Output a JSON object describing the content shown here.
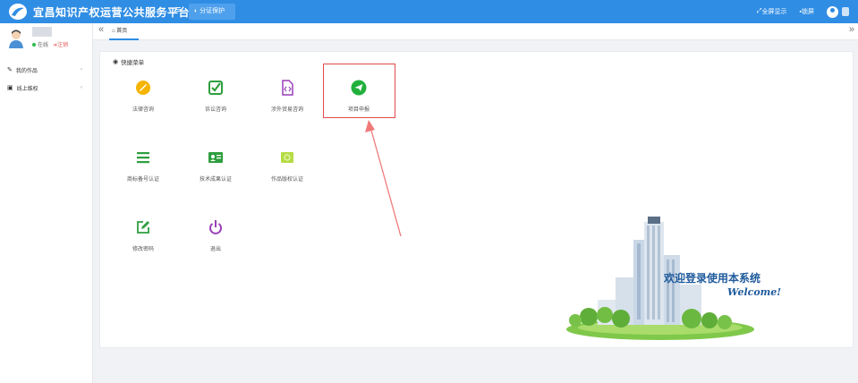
{
  "topbar": {
    "title": "宜昌知识产权运营公共服务平台",
    "menu_toggle": "≡",
    "active_tab": "◐ 分证保护",
    "right": [
      {
        "icon": "fullscreen-icon",
        "label": "全屏显示"
      },
      {
        "icon": "lock-icon",
        "label": "锁屏"
      }
    ]
  },
  "user": {
    "status": "在线",
    "logout": "注销"
  },
  "sidebar": {
    "items": [
      {
        "label": "我的作品",
        "icon": "book-icon"
      },
      {
        "label": "线上维权",
        "icon": "briefcase-icon"
      }
    ]
  },
  "tabstrip": {
    "home": "首页",
    "left_arrow": "«",
    "right_arrow": "»"
  },
  "panel": {
    "header": "快捷菜单",
    "items": [
      {
        "label": "法律咨询",
        "icon": "legal-icon",
        "color": "#f4b400"
      },
      {
        "label": "诉讼咨询",
        "icon": "check-square-icon",
        "color": "#2e9e3e"
      },
      {
        "label": "涉外贸易咨询",
        "icon": "code-file-icon",
        "color": "#9a3fb8"
      },
      {
        "label": "项目申报",
        "icon": "paper-plane-icon",
        "color": "#22b03c"
      },
      {
        "label": "商标备号认证",
        "icon": "list-icon",
        "color": "#2e9e3e"
      },
      {
        "label": "技术成果认证",
        "icon": "id-card-icon",
        "color": "#2e9e3e"
      },
      {
        "label": "作品版权认证",
        "icon": "copyright-icon",
        "color": "#b5dc42"
      },
      {
        "label": "修改密码",
        "icon": "edit-icon",
        "color": "#2e9e3e"
      },
      {
        "label": "退出",
        "icon": "power-icon",
        "color": "#9a3fb8"
      }
    ]
  },
  "welcome": {
    "cn": "欢迎登录使用本系统",
    "en": "Welcome!"
  },
  "colors": {
    "accent": "#2f8de4",
    "highlight": "#e24a4a"
  }
}
